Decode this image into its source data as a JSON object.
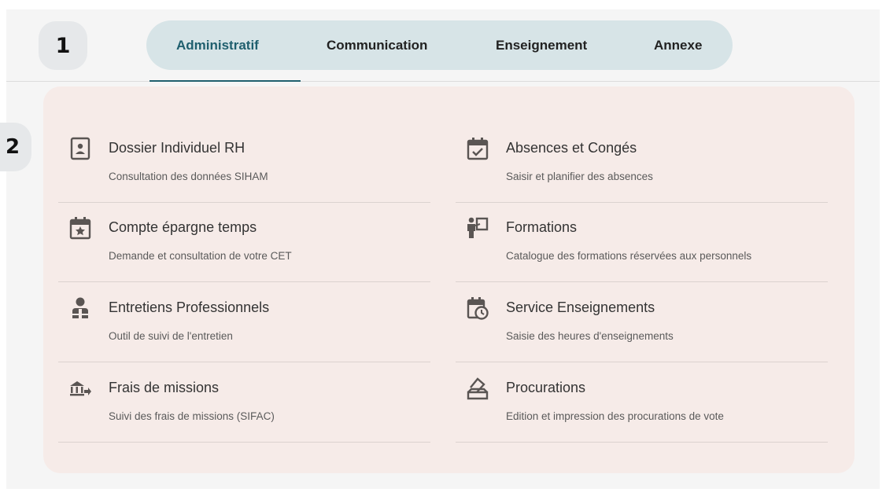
{
  "steps": {
    "one": "1",
    "two": "2"
  },
  "tabs": [
    {
      "label": "Administratif",
      "active": true
    },
    {
      "label": "Communication",
      "active": false
    },
    {
      "label": "Enseignement",
      "active": false
    },
    {
      "label": "Annexe",
      "active": false
    }
  ],
  "colors": {
    "active_tab": "#1f5f6e",
    "tab_bar": "#d7e4e7",
    "panel": "#f6ebe8",
    "icon": "#5a5553"
  },
  "items": [
    {
      "title": "Dossier Individuel RH",
      "subtitle": "Consultation des données SIHAM",
      "icon": "id-badge-icon"
    },
    {
      "title": "Absences et Congés",
      "subtitle": "Saisir et planifier des absences",
      "icon": "calendar-check-icon"
    },
    {
      "title": "Compte épargne temps",
      "subtitle": "Demande et consultation de votre CET",
      "icon": "calendar-star-icon"
    },
    {
      "title": "Formations",
      "subtitle": "Catalogue des formations réservées aux personnels",
      "icon": "teacher-board-icon"
    },
    {
      "title": "Entretiens Professionnels",
      "subtitle": "Outil de suivi de l'entretien",
      "icon": "meeting-person-icon"
    },
    {
      "title": "Service Enseignements",
      "subtitle": "Saisie des heures d'enseignements",
      "icon": "calendar-clock-icon"
    },
    {
      "title": "Frais de missions",
      "subtitle": "Suivi des frais de missions (SIFAC)",
      "icon": "bank-transfer-icon"
    },
    {
      "title": "Procurations",
      "subtitle": "Edition et impression des procurations de vote",
      "icon": "ballot-box-icon"
    }
  ]
}
